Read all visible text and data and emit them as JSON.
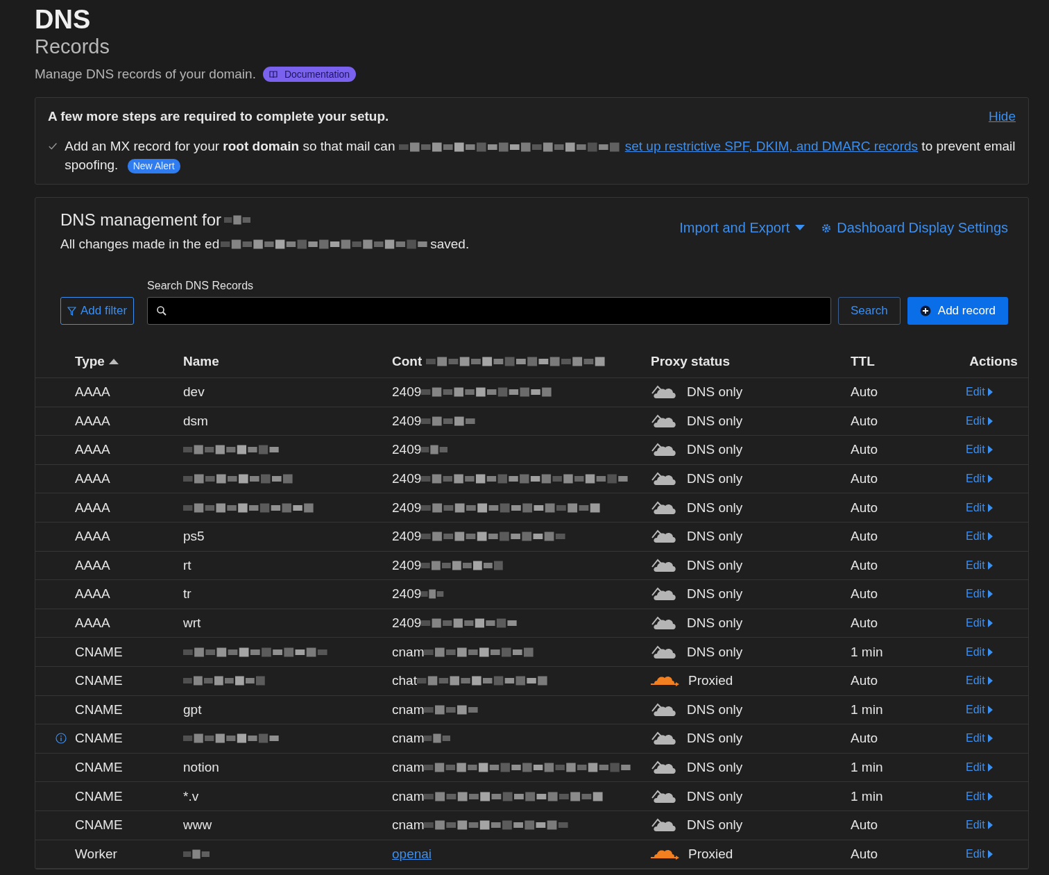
{
  "header": {
    "title": "DNS",
    "subtitle": "Records",
    "description": "Manage DNS records of your domain.",
    "doc_badge": "Documentation"
  },
  "setup": {
    "heading": "A few more steps are required to complete your setup.",
    "hide": "Hide",
    "items": [
      {
        "checked": true,
        "segments": [
          {
            "kind": "text",
            "text": "Add an MX record for your **root domain** so that mail can"
          },
          {
            "kind": "redacted"
          },
          {
            "kind": "link",
            "text": "set up restrictive SPF, DKIM, and DMARC records"
          },
          {
            "kind": "text",
            "text": "to prevent email spoofing."
          }
        ],
        "badge": "New Alert"
      }
    ]
  },
  "management": {
    "title": [
      {
        "kind": "text",
        "text": "DNS management for"
      },
      {
        "kind": "redacted"
      }
    ],
    "subtitle": [
      {
        "kind": "text",
        "text": "All changes made in the ed"
      },
      {
        "kind": "redacted"
      },
      {
        "kind": "text",
        "text": "saved."
      }
    ],
    "import_export": "Import and Export",
    "display_settings": "Dashboard Display Settings"
  },
  "search": {
    "label": "Search DNS Records",
    "add_filter": "Add filter",
    "search_button": "Search",
    "add_record": "Add record"
  },
  "table": {
    "columns": [
      {
        "segments": [
          {
            "kind": "text",
            "text": "Type"
          }
        ],
        "sorted": true
      },
      {
        "segments": [
          {
            "kind": "text",
            "text": "Name"
          }
        ]
      },
      {
        "segments": [
          {
            "kind": "text",
            "text": "Cont"
          },
          {
            "kind": "redacted"
          }
        ]
      },
      {
        "segments": [
          {
            "kind": "text",
            "text": "Proxy status"
          }
        ]
      },
      {
        "segments": [
          {
            "kind": "text",
            "text": "TTL"
          }
        ]
      },
      {
        "segments": [
          {
            "kind": "text",
            "text": "Actions"
          }
        ]
      }
    ],
    "rows": [
      {
        "type": "AAAA",
        "name": [
          {
            "kind": "text",
            "text": "dev"
          }
        ],
        "content": [
          {
            "kind": "text",
            "text": "2409"
          },
          {
            "kind": "redacted"
          }
        ],
        "proxied": false,
        "proxy_label": "DNS only",
        "ttl": "Auto",
        "action": "Edit",
        "info": false
      },
      {
        "type": "AAAA",
        "name": [
          {
            "kind": "text",
            "text": "dsm"
          }
        ],
        "content": [
          {
            "kind": "text",
            "text": "2409"
          },
          {
            "kind": "redacted"
          }
        ],
        "proxied": false,
        "proxy_label": "DNS only",
        "ttl": "Auto",
        "action": "Edit",
        "info": false
      },
      {
        "type": "AAAA",
        "name": [
          {
            "kind": "redacted"
          }
        ],
        "content": [
          {
            "kind": "text",
            "text": "2409"
          },
          {
            "kind": "redacted"
          }
        ],
        "proxied": false,
        "proxy_label": "DNS only",
        "ttl": "Auto",
        "action": "Edit",
        "info": false
      },
      {
        "type": "AAAA",
        "name": [
          {
            "kind": "redacted"
          }
        ],
        "content": [
          {
            "kind": "text",
            "text": "2409"
          },
          {
            "kind": "redacted"
          }
        ],
        "proxied": false,
        "proxy_label": "DNS only",
        "ttl": "Auto",
        "action": "Edit",
        "info": false
      },
      {
        "type": "AAAA",
        "name": [
          {
            "kind": "redacted"
          }
        ],
        "content": [
          {
            "kind": "text",
            "text": "2409"
          },
          {
            "kind": "redacted"
          }
        ],
        "proxied": false,
        "proxy_label": "DNS only",
        "ttl": "Auto",
        "action": "Edit",
        "info": false
      },
      {
        "type": "AAAA",
        "name": [
          {
            "kind": "text",
            "text": "ps5"
          }
        ],
        "content": [
          {
            "kind": "text",
            "text": "2409"
          },
          {
            "kind": "redacted"
          }
        ],
        "proxied": false,
        "proxy_label": "DNS only",
        "ttl": "Auto",
        "action": "Edit",
        "info": false
      },
      {
        "type": "AAAA",
        "name": [
          {
            "kind": "text",
            "text": "rt"
          }
        ],
        "content": [
          {
            "kind": "text",
            "text": "2409"
          },
          {
            "kind": "redacted"
          }
        ],
        "proxied": false,
        "proxy_label": "DNS only",
        "ttl": "Auto",
        "action": "Edit",
        "info": false
      },
      {
        "type": "AAAA",
        "name": [
          {
            "kind": "text",
            "text": "tr"
          }
        ],
        "content": [
          {
            "kind": "text",
            "text": "2409"
          },
          {
            "kind": "redacted"
          }
        ],
        "proxied": false,
        "proxy_label": "DNS only",
        "ttl": "Auto",
        "action": "Edit",
        "info": false
      },
      {
        "type": "AAAA",
        "name": [
          {
            "kind": "text",
            "text": "wrt"
          }
        ],
        "content": [
          {
            "kind": "text",
            "text": "2409"
          },
          {
            "kind": "redacted"
          }
        ],
        "proxied": false,
        "proxy_label": "DNS only",
        "ttl": "Auto",
        "action": "Edit",
        "info": false
      },
      {
        "type": "CNAME",
        "name": [
          {
            "kind": "redacted"
          }
        ],
        "content": [
          {
            "kind": "text",
            "text": "cnam"
          },
          {
            "kind": "redacted"
          }
        ],
        "proxied": false,
        "proxy_label": "DNS only",
        "ttl": "1 min",
        "action": "Edit",
        "info": false
      },
      {
        "type": "CNAME",
        "name": [
          {
            "kind": "redacted"
          }
        ],
        "content": [
          {
            "kind": "text",
            "text": "chat"
          },
          {
            "kind": "redacted"
          }
        ],
        "proxied": true,
        "proxy_label": "Proxied",
        "ttl": "Auto",
        "action": "Edit",
        "info": false
      },
      {
        "type": "CNAME",
        "name": [
          {
            "kind": "text",
            "text": "gpt"
          }
        ],
        "content": [
          {
            "kind": "text",
            "text": "cnam"
          },
          {
            "kind": "redacted"
          }
        ],
        "proxied": false,
        "proxy_label": "DNS only",
        "ttl": "1 min",
        "action": "Edit",
        "info": false
      },
      {
        "type": "CNAME",
        "name": [
          {
            "kind": "redacted"
          }
        ],
        "content": [
          {
            "kind": "text",
            "text": "cnam"
          },
          {
            "kind": "redacted"
          }
        ],
        "proxied": false,
        "proxy_label": "DNS only",
        "ttl": "Auto",
        "action": "Edit",
        "info": true
      },
      {
        "type": "CNAME",
        "name": [
          {
            "kind": "text",
            "text": "notion"
          }
        ],
        "content": [
          {
            "kind": "text",
            "text": "cnam"
          },
          {
            "kind": "redacted"
          }
        ],
        "proxied": false,
        "proxy_label": "DNS only",
        "ttl": "1 min",
        "action": "Edit",
        "info": false
      },
      {
        "type": "CNAME",
        "name": [
          {
            "kind": "text",
            "text": "*.v"
          }
        ],
        "content": [
          {
            "kind": "text",
            "text": "cnam"
          },
          {
            "kind": "redacted"
          }
        ],
        "proxied": false,
        "proxy_label": "DNS only",
        "ttl": "1 min",
        "action": "Edit",
        "info": false
      },
      {
        "type": "CNAME",
        "name": [
          {
            "kind": "text",
            "text": "www"
          }
        ],
        "content": [
          {
            "kind": "text",
            "text": "cnam"
          },
          {
            "kind": "redacted"
          }
        ],
        "proxied": false,
        "proxy_label": "DNS only",
        "ttl": "Auto",
        "action": "Edit",
        "info": false
      },
      {
        "type": "Worker",
        "name": [
          {
            "kind": "redacted"
          }
        ],
        "content": [
          {
            "kind": "link",
            "text": "openai"
          }
        ],
        "proxied": true,
        "proxy_label": "Proxied",
        "ttl": "Auto",
        "action": "Edit",
        "info": false
      }
    ]
  }
}
